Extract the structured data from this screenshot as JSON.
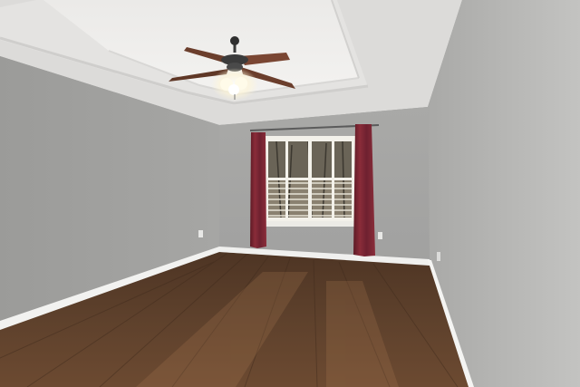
{
  "scene": {
    "type": "photo",
    "subject": "empty-bedroom",
    "elements": [
      "tray-ceiling",
      "ceiling-fan",
      "window",
      "curtains",
      "hardwood-floor",
      "baseboards",
      "wall-outlets"
    ]
  },
  "colors": {
    "ceiling": "#e9e8e6",
    "tray_inner": "#f1f0ee",
    "back_wall": "#a4a4a2",
    "left_wall": "#9d9d9b",
    "right_wall": "#b9b9b7",
    "floor": "#5a3e2a",
    "floor_light": "#7a5638",
    "baseboard": "#f2f2f0",
    "curtain": "#7d2633",
    "window_frame": "#f3f1ea",
    "fan_blade": "#6b3e2c",
    "fan_light": "#fffbe9"
  }
}
